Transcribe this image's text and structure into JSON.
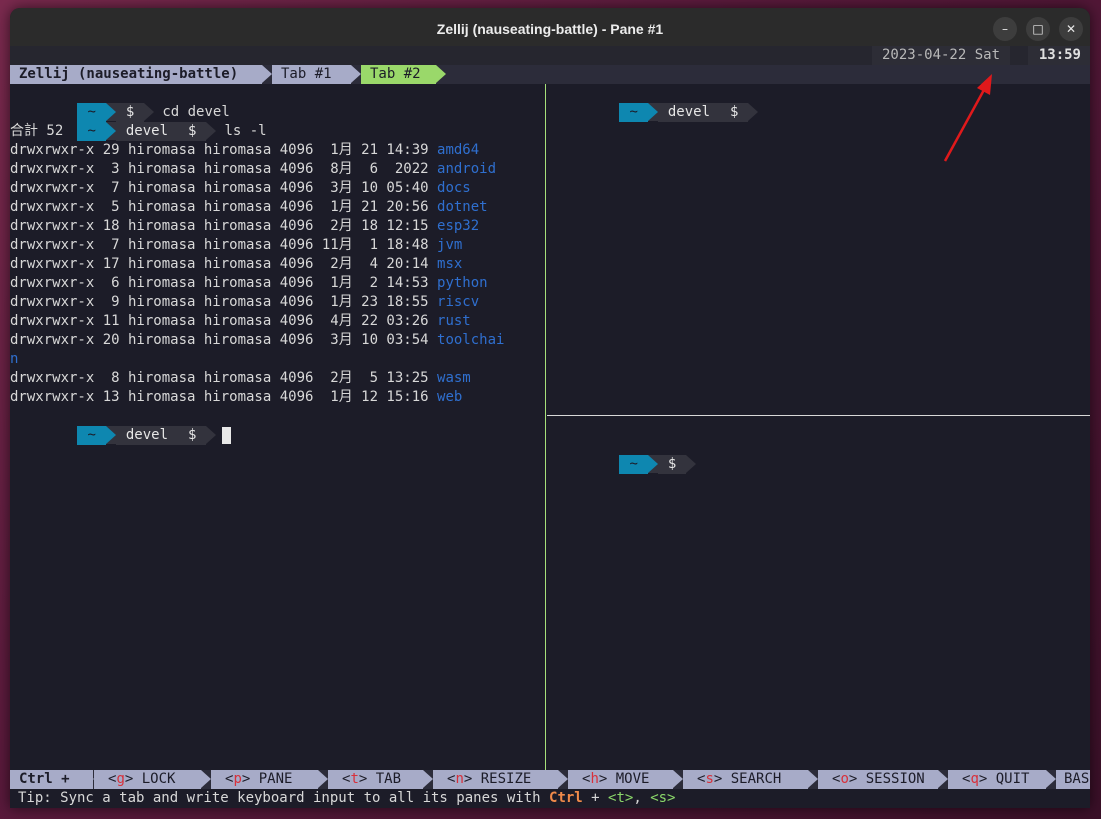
{
  "window": {
    "title": "Zellij (nauseating-battle) - Pane #1",
    "buttons": {
      "minimize": "–",
      "maximize": "□",
      "close": "✕"
    }
  },
  "topbar": {
    "date": "2023-04-22 Sat",
    "clock": "13:59"
  },
  "tabbar": {
    "session": "Zellij (nauseating-battle)",
    "tabs": [
      {
        "label": "Tab #1",
        "active": false
      },
      {
        "label": "Tab #2",
        "active": true
      }
    ]
  },
  "left_pane": {
    "prompt1": {
      "home": "~",
      "symbol": "$",
      "command": "cd devel"
    },
    "prompt2": {
      "home": "~",
      "dir": "devel",
      "symbol": "$",
      "command": "ls -l"
    },
    "total": "合計 52",
    "rows": [
      {
        "meta": "drwxrwxr-x 29 hiromasa hiromasa 4096  1月 21 14:39 ",
        "name": "amd64"
      },
      {
        "meta": "drwxrwxr-x  3 hiromasa hiromasa 4096  8月  6  2022 ",
        "name": "android"
      },
      {
        "meta": "drwxrwxr-x  7 hiromasa hiromasa 4096  3月 10 05:40 ",
        "name": "docs"
      },
      {
        "meta": "drwxrwxr-x  5 hiromasa hiromasa 4096  1月 21 20:56 ",
        "name": "dotnet"
      },
      {
        "meta": "drwxrwxr-x 18 hiromasa hiromasa 4096  2月 18 12:15 ",
        "name": "esp32"
      },
      {
        "meta": "drwxrwxr-x  7 hiromasa hiromasa 4096 11月  1 18:48 ",
        "name": "jvm"
      },
      {
        "meta": "drwxrwxr-x 17 hiromasa hiromasa 4096  2月  4 20:14 ",
        "name": "msx"
      },
      {
        "meta": "drwxrwxr-x  6 hiromasa hiromasa 4096  1月  2 14:53 ",
        "name": "python"
      },
      {
        "meta": "drwxrwxr-x  9 hiromasa hiromasa 4096  1月 23 18:55 ",
        "name": "riscv"
      },
      {
        "meta": "drwxrwxr-x 11 hiromasa hiromasa 4096  4月 22 03:26 ",
        "name": "rust"
      },
      {
        "meta": "drwxrwxr-x 20 hiromasa hiromasa 4096  3月 10 03:54 ",
        "name": "toolchai"
      },
      {
        "meta": "",
        "name": "n"
      },
      {
        "meta": "drwxrwxr-x  8 hiromasa hiromasa 4096  2月  5 13:25 ",
        "name": "wasm"
      },
      {
        "meta": "drwxrwxr-x 13 hiromasa hiromasa 4096  1月 12 15:16 ",
        "name": "web"
      }
    ],
    "prompt3": {
      "home": "~",
      "dir": "devel",
      "symbol": "$"
    }
  },
  "right_top_pane": {
    "home": "~",
    "dir": "devel",
    "symbol": "$"
  },
  "right_bottom_pane": {
    "home": "~",
    "symbol": "$"
  },
  "statusbar": {
    "ctrl": "Ctrl +",
    "modes": [
      {
        "key": "g",
        "label": "LOCK"
      },
      {
        "key": "p",
        "label": "PANE"
      },
      {
        "key": "t",
        "label": "TAB"
      },
      {
        "key": "n",
        "label": "RESIZE"
      },
      {
        "key": "h",
        "label": "MOVE"
      },
      {
        "key": "s",
        "label": "SEARCH"
      },
      {
        "key": "o",
        "label": "SESSION"
      },
      {
        "key": "q",
        "label": "QUIT"
      }
    ],
    "base": "BASE"
  },
  "tip": {
    "prefix": "Tip: Sync a tab and write keyboard input to all its panes with ",
    "ctrl": "Ctrl",
    "plus": " + ",
    "key1": "<t>",
    "sep": ", ",
    "key2": "<s>"
  },
  "colors": {
    "accent_green": "#a6e07a",
    "prompt_blue": "#0e87b0",
    "dir_blue": "#2f6fcf",
    "arrow_red": "#e0191b"
  }
}
